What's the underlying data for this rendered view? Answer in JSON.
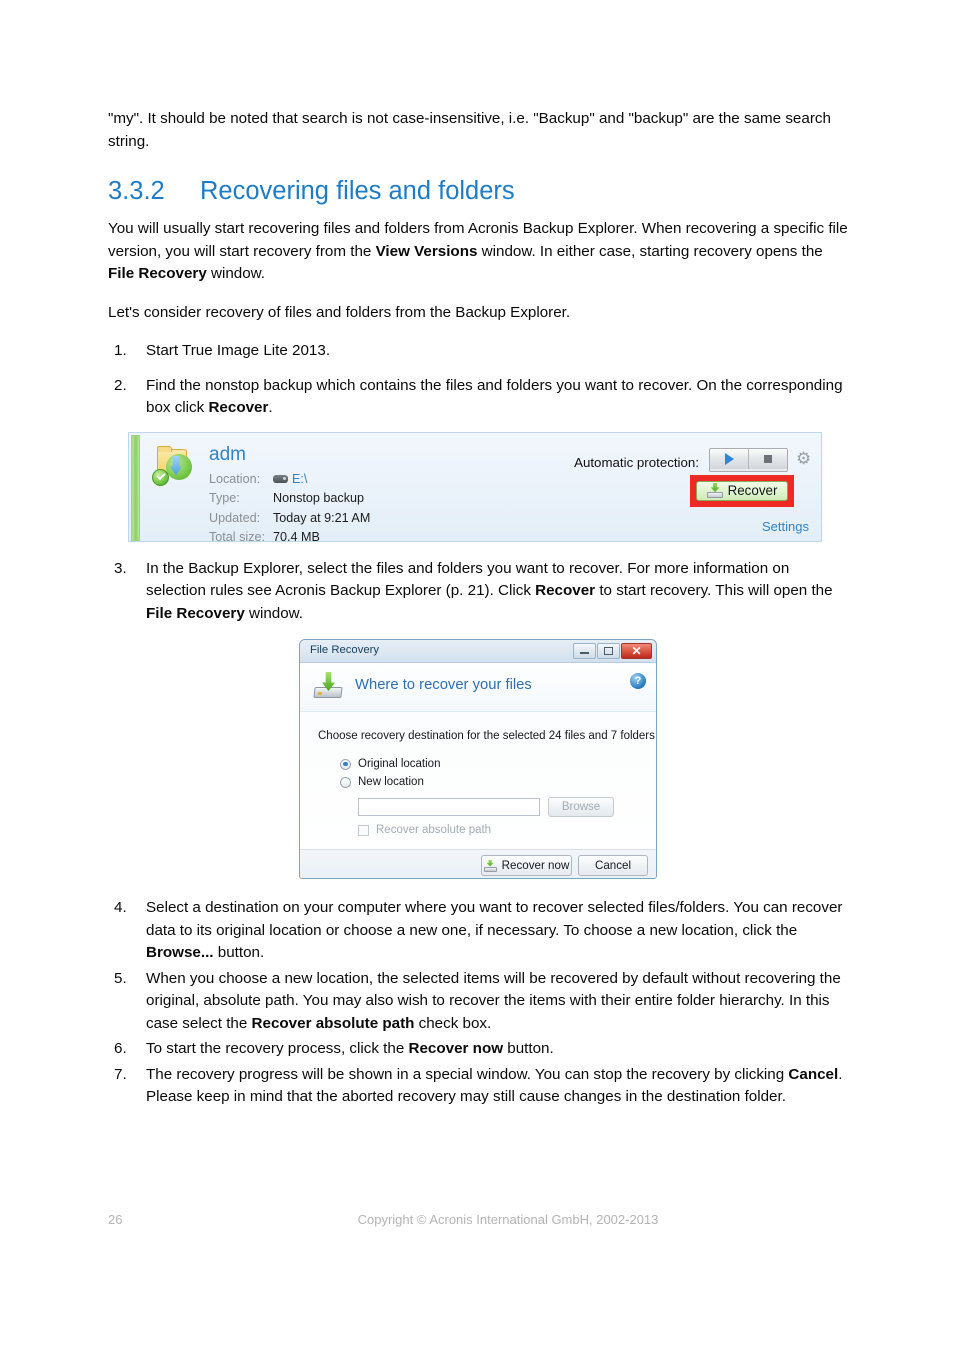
{
  "intro": {
    "paragraph": "\"my\". It should be noted that search is not case-insensitive, i.e. \"Backup\" and \"backup\" are the same search string."
  },
  "heading": {
    "number": "3.3.2",
    "title": "Recovering files and folders"
  },
  "paragraphs": {
    "p1_part1": "You will usually start recovering files and folders from Acronis Backup Explorer. When recovering a specific file version, you will start recovery from the ",
    "p1_bold1": "View Versions",
    "p1_part2": " window. In either case, starting recovery opens the ",
    "p1_bold2": "File Recovery",
    "p1_part3": " window.",
    "p2": "Let's consider recovery of files and folders from the Backup Explorer."
  },
  "steps": {
    "s1": {
      "marker": "1.",
      "text": "Start True Image Lite 2013."
    },
    "s2": {
      "marker": "2.",
      "part1": "Find the nonstop backup which contains the files and folders you want to recover. On the corresponding box click ",
      "bold1": "Recover",
      "part2": "."
    },
    "s3": {
      "marker": "3.",
      "part1": "In the Backup Explorer, select the files and folders you want to recover. For more information on selection rules see Acronis Backup Explorer (p. 21). Click ",
      "bold1": "Recover",
      "part2": " to start recovery. This will open the ",
      "bold2": "File Recovery",
      "part3": " window."
    },
    "s4": {
      "marker": "4.",
      "part1": "Select a destination on your computer where you want to recover selected files/folders. You can recover data to its original location or choose a new one, if necessary. To choose a new location, click the ",
      "bold1": "Browse...",
      "part2": " button."
    },
    "s5": {
      "marker": "5.",
      "part1": "When you choose a new location, the selected items will be recovered by default without recovering the original, absolute path. You may also wish to recover the items with their entire folder hierarchy. In this case select the ",
      "bold1": "Recover absolute path",
      "part2": " check box."
    },
    "s6": {
      "marker": "6.",
      "part1": "To start the recovery process, click the ",
      "bold1": "Recover now",
      "part2": " button."
    },
    "s7": {
      "marker": "7.",
      "part1": "The recovery progress will be shown in a special window. You can stop the recovery by clicking ",
      "bold1": "Cancel",
      "part2": ". Please keep in mind that the aborted recovery may still cause changes in the destination folder."
    }
  },
  "backup_box": {
    "name": "adm",
    "rows": [
      {
        "label": "Location:",
        "value": "E:\\"
      },
      {
        "label": "Type:",
        "value": "Nonstop backup"
      },
      {
        "label": "Updated:",
        "value": "Today at 9:21 AM"
      },
      {
        "label": "Total size:",
        "value": "70.4 MB"
      }
    ],
    "location_label": "Location:",
    "location_value": "E:\\",
    "type_label": "Type:",
    "type_value": "Nonstop backup",
    "updated_label": "Updated:",
    "updated_value": "Today at 9:21 AM",
    "total_size_label": "Total size:",
    "total_size_value": "70.4 MB",
    "auto_protection_label": "Automatic protection:",
    "recover_button": "Recover",
    "settings_link": "Settings",
    "accent_green": "#8ccf63",
    "highlight_red": "#ef2a24",
    "link_blue": "#2f83c6"
  },
  "dialog": {
    "title": "File Recovery",
    "header_title": "Where to recover your files",
    "prompt": "Choose recovery destination for the selected 24 files and 7 folders:",
    "radio_original": "Original location",
    "radio_new": "New location",
    "path_value": "",
    "path_placeholder": "",
    "browse_button": "Browse",
    "checkbox_label": "Recover absolute path",
    "recover_now_button": "Recover now",
    "cancel_button": "Cancel",
    "help_glyph": "?",
    "close_glyph": "✕"
  },
  "footer": {
    "page_number": "26",
    "copyright": "Copyright © Acronis International GmbH, 2002-2013"
  }
}
